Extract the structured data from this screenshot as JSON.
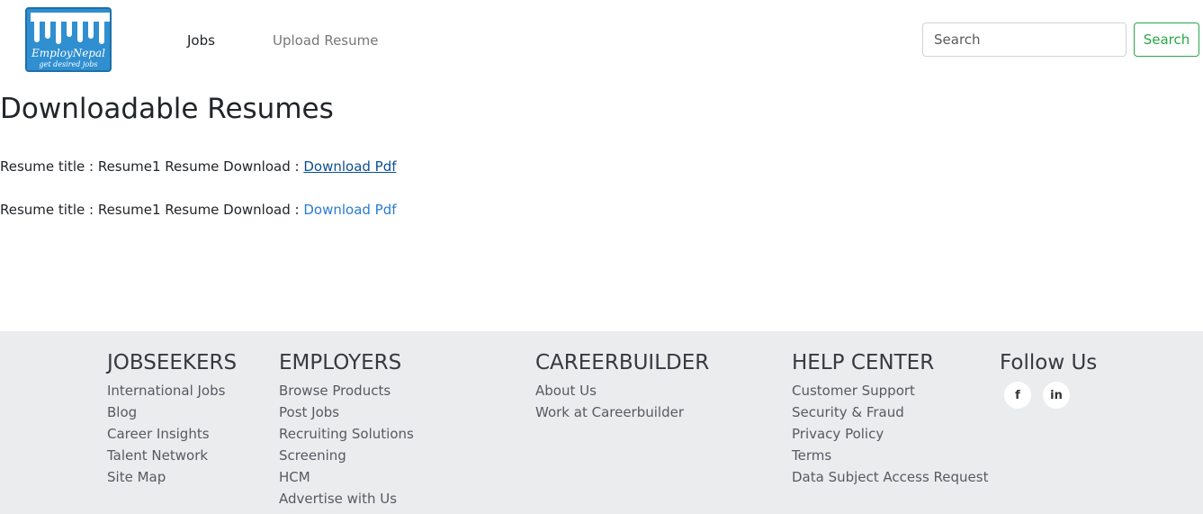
{
  "navbar": {
    "logo": {
      "name": "EmployNepal",
      "tagline": "get desired jobs",
      "color": "#2f8fd0"
    },
    "links": [
      {
        "label": "Jobs"
      },
      {
        "label": "Upload Resume"
      }
    ],
    "search": {
      "placeholder": "Search",
      "button_label": "Search",
      "button_color": "#28a745"
    }
  },
  "main": {
    "title": "Downloadable Resumes",
    "resumes": [
      {
        "text": "Resume title : Resume1 Resume Download : ",
        "link_label": "Download Pdf"
      },
      {
        "text": "Resume title : Resume1 Resume Download : ",
        "link_label": "Download Pdf"
      }
    ]
  },
  "footer": {
    "background": "#ebecee",
    "jobseekers": {
      "heading": "JOBSEEKERS",
      "items": [
        "International Jobs",
        "Blog",
        "Career Insights",
        "Talent Network",
        "Site Map"
      ]
    },
    "employers": {
      "heading": "EMPLOYERS",
      "items": [
        "Browse Products",
        "Post Jobs",
        "Recruiting Solutions",
        "Screening",
        "HCM",
        "Advertise with Us"
      ]
    },
    "careerbuilder": {
      "heading": "CAREERBUILDER",
      "items": [
        "About Us",
        "Work at Careerbuilder"
      ]
    },
    "help_center": {
      "heading": "HELP CENTER",
      "items": [
        "Customer Support",
        "Security & Fraud",
        "Privacy Policy",
        "Terms",
        "Data Subject Access Request"
      ]
    },
    "follow": {
      "heading": "Follow Us",
      "icons": [
        {
          "name": "facebook-icon",
          "glyph": "f"
        },
        {
          "name": "linkedin-icon",
          "glyph": "in"
        }
      ]
    }
  }
}
